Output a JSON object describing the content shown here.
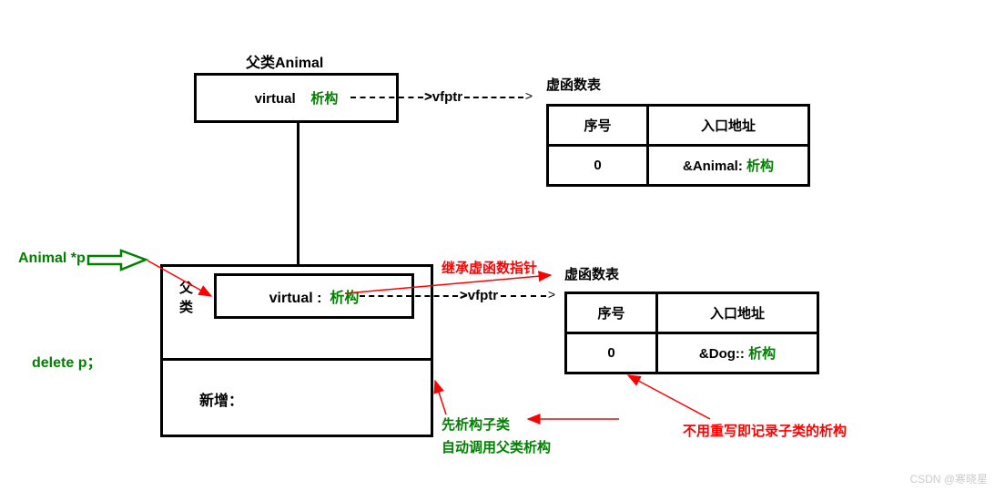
{
  "parent": {
    "title": "父类Animal",
    "virtual_label": "virtual",
    "destructor": "析构",
    "vfptr": ">vfptr"
  },
  "child": {
    "side_label": "父类",
    "virtual_label": "virtual :",
    "destructor": "析构",
    "vfptr": ">vfptr",
    "new_label": "新增："
  },
  "vtable1": {
    "title": "虚函数表",
    "col1": "序号",
    "col2": "入口地址",
    "row_seq": "0",
    "row_addr_prefix": "&Animal:",
    "row_addr_suffix": "析构"
  },
  "vtable2": {
    "title": "虚函数表",
    "col1": "序号",
    "col2": "入口地址",
    "row_seq": "0",
    "row_addr_prefix": "&Dog::",
    "row_addr_suffix": "析构"
  },
  "labels": {
    "inherit": "继承虚函数指针",
    "animal_p": "Animal *p",
    "delete_p": "delete p；",
    "destructor_child": "先析构子类",
    "auto_call": "自动调用父类析构",
    "no_rewrite": "不用重写即记录子类的析构",
    "watermark": "CSDN @寒晓星"
  }
}
